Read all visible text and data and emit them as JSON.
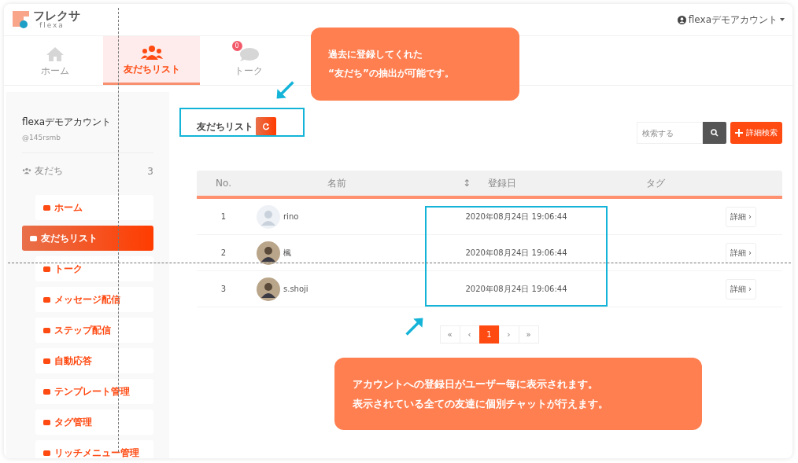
{
  "header": {
    "logo_text": "フレクサ",
    "logo_subtext": "flexa",
    "account": "flexaデモアカウント"
  },
  "tabs": [
    {
      "label": "ホーム",
      "kind": "home",
      "selected": false
    },
    {
      "label": "友だちリスト",
      "kind": "friends",
      "selected": true
    },
    {
      "label": "トーク",
      "kind": "talk",
      "selected": false,
      "badge": "0"
    }
  ],
  "sidebar": {
    "account_name": "flexaデモアカウント",
    "account_id": "@145rsmb",
    "friends_label": "友だち",
    "friends_count": "3",
    "items": [
      {
        "label": "ホーム",
        "selected": false
      },
      {
        "label": "友だちリスト",
        "selected": true
      },
      {
        "label": "トーク",
        "selected": false
      },
      {
        "label": "メッセージ配信",
        "selected": false
      },
      {
        "label": "ステップ配信",
        "selected": false
      },
      {
        "label": "自動応答",
        "selected": false
      },
      {
        "label": "テンプレート管理",
        "selected": false
      },
      {
        "label": "タグ管理",
        "selected": false
      },
      {
        "label": "リッチメニュー管理",
        "selected": false
      }
    ]
  },
  "page_title": "友だちリスト",
  "search": {
    "placeholder": "検索する",
    "advanced_button": "詳細検索"
  },
  "table": {
    "columns": [
      "No.",
      "名前",
      "↕",
      "登録日",
      "タグ"
    ],
    "rows": [
      {
        "no": "1",
        "name": "rino",
        "kind": "default",
        "date": "2020年08月24日 19:06:44",
        "action": "詳細 ›"
      },
      {
        "no": "2",
        "name": "楓",
        "kind": "photo",
        "date": "2020年08月24日 19:06:44",
        "action": "詳細 ›"
      },
      {
        "no": "3",
        "name": "s.shoji",
        "kind": "photo",
        "date": "2020年08月24日 19:06:44",
        "action": "詳細 ›"
      }
    ]
  },
  "pagination": [
    {
      "label": "«",
      "selected": false
    },
    {
      "label": "‹",
      "selected": false
    },
    {
      "label": "1",
      "selected": true
    },
    {
      "label": "›",
      "selected": false
    },
    {
      "label": "»",
      "selected": false
    }
  ],
  "callouts": [
    {
      "lines": [
        "過去に登録してくれた",
        "“友だち”の抽出が可能です。"
      ]
    },
    {
      "lines": [
        "アカウントへの登録日がユーザー毎に表示されます。",
        "表示されている全ての友達に個別チャットが行えます。"
      ]
    }
  ]
}
